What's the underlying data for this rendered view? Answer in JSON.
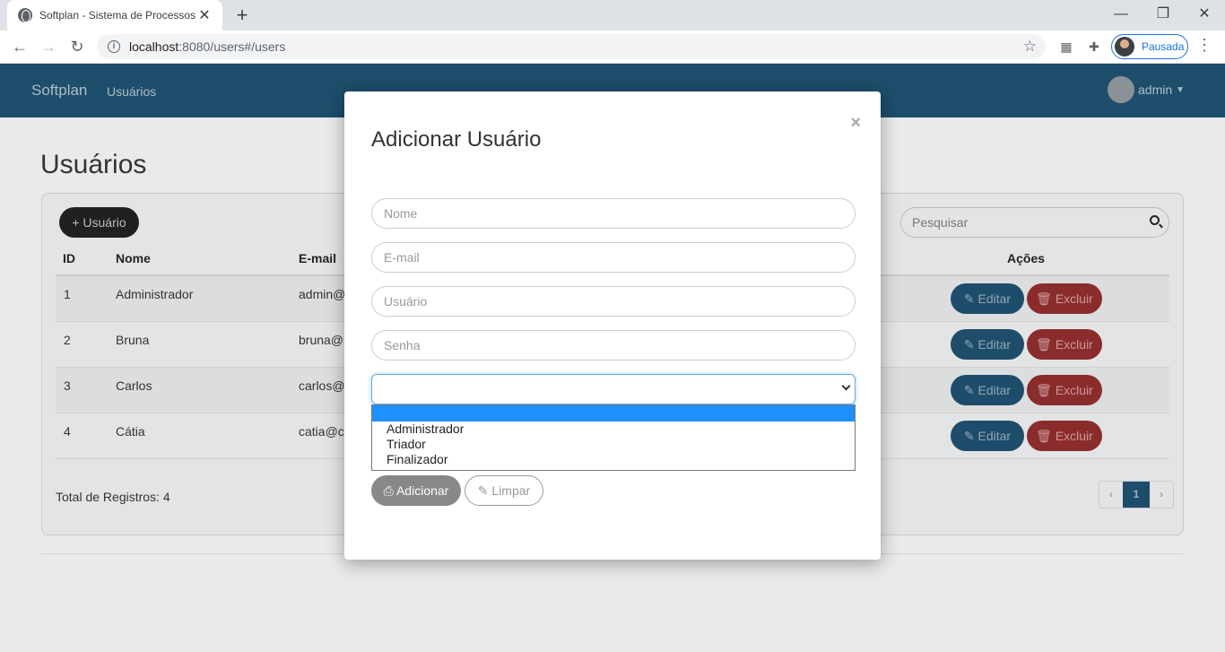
{
  "browser": {
    "tab_title": "Softplan - Sistema de Processos",
    "tab_close": "✕",
    "new_tab": "+",
    "url_host": "localhost",
    "url_rest": ":8080/users#/users",
    "profile_label": "Pausada",
    "min": "—",
    "restore": "❐",
    "close": "✕",
    "back": "←",
    "forward": "→",
    "reload": "↻",
    "star": "☆",
    "more": "⋮"
  },
  "app": {
    "brand": "Softplan",
    "nav_users": "Usuários",
    "user_name": "admin"
  },
  "page": {
    "title": "Usuários",
    "add_button": "+ Usuário",
    "search_placeholder": "Pesquisar",
    "columns": {
      "id": "ID",
      "name": "Nome",
      "email": "E-mail",
      "actions": "Ações"
    },
    "rows": [
      {
        "id": "1",
        "name": "Administrador",
        "email": "admin@"
      },
      {
        "id": "2",
        "name": "Bruna",
        "email": "bruna@"
      },
      {
        "id": "3",
        "name": "Carlos",
        "email": "carlos@"
      },
      {
        "id": "4",
        "name": "Cátia",
        "email": "catia@c"
      }
    ],
    "edit_label": "Editar",
    "delete_label": "Excluir",
    "total_label": "Total de Registros: 4",
    "pager": {
      "prev": "‹",
      "current": "1",
      "next": "›"
    }
  },
  "modal": {
    "title": "Adicionar Usuário",
    "close": "×",
    "name_placeholder": "Nome",
    "email_placeholder": "E-mail",
    "user_placeholder": "Usuário",
    "password_placeholder": "Senha",
    "role_options": [
      "",
      "Administrador",
      "Triador",
      "Finalizador"
    ],
    "add_button": "Adicionar",
    "clear_button": "Limpar"
  },
  "colors": {
    "navbar": "#1d4e6b",
    "edit": "#1e4d6b",
    "delete": "#8b2c2c",
    "select_highlight": "#1e90ff"
  }
}
